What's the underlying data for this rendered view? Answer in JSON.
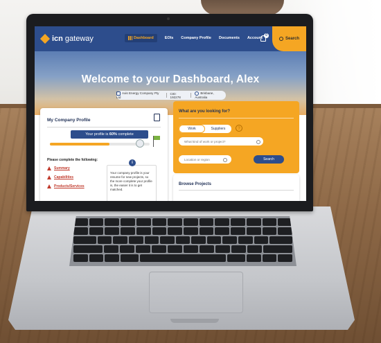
{
  "nav": {
    "logo_bold": "icn",
    "logo_light": "gateway",
    "links": [
      "Dashboard",
      "EOIs",
      "Company Profile",
      "Documents",
      "Account"
    ],
    "notification_count": "0",
    "search_label": "Search"
  },
  "hero": {
    "title": "Welcome to your Dashboard, Alex",
    "company": "Axis Energy Company Pty Ltd",
    "cid": "CID: 192278",
    "location": "Brisbane, Australia"
  },
  "profile": {
    "title": "My Company Profile",
    "badge_prefix": "Your profile is",
    "badge_value": "60%",
    "badge_suffix": "complete",
    "progress": 0.6,
    "complete_label": "Please complete the following:",
    "items": [
      "Summary",
      "Capabilities",
      "Products/Services"
    ],
    "tip": "Your company profile is your resume for new projects, so the more complete your profile is, the easier it is to get matched."
  },
  "looking": {
    "title": "What are you looking for?",
    "tabs": [
      "Work",
      "Suppliers"
    ],
    "help": "?",
    "work_placeholder": "What kind of work or project?",
    "location_placeholder": "Location or region",
    "search_button": "Search"
  },
  "browse": {
    "title": "Browse Projects"
  },
  "colors": {
    "navy": "#2d4d8c",
    "orange": "#f5a623",
    "warning": "#c0392b"
  }
}
